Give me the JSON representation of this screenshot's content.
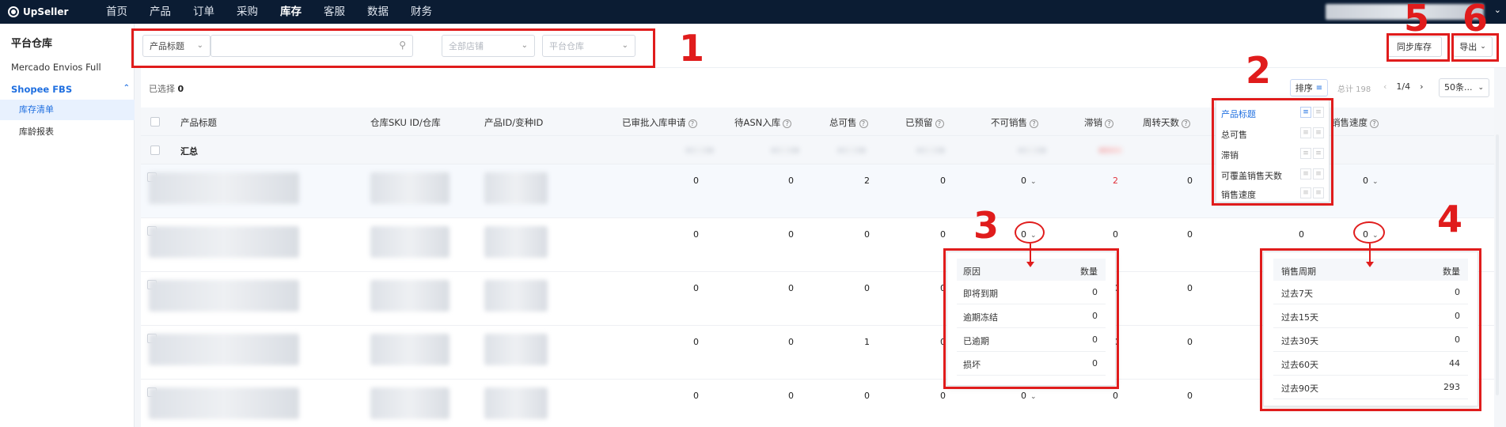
{
  "app": {
    "logo": "UpSeller"
  },
  "nav": [
    "首页",
    "产品",
    "订单",
    "采购",
    "库存",
    "客服",
    "数据",
    "财务"
  ],
  "nav_active": "库存",
  "sidebar": {
    "title": "平台仓库",
    "items": [
      "Mercado Envios Full"
    ],
    "group": "Shopee FBS",
    "sub_items": [
      "库存清单",
      "库龄报表"
    ]
  },
  "filters": {
    "search_field": "产品标题",
    "search_value": "",
    "shop_placeholder": "全部店铺",
    "warehouse_placeholder": "平台仓库",
    "sync_button": "同步库存",
    "export_button": "导出"
  },
  "toolbar": {
    "selected_label": "已选择",
    "selected_count": "0",
    "sort_button": "排序",
    "total": "总计 198",
    "page": "1/4",
    "page_size": "50条..."
  },
  "columns": [
    "产品标题",
    "仓库SKU ID/仓库",
    "产品ID/变种ID",
    "已审批入库申请",
    "待ASN入库",
    "总可售",
    "已预留",
    "不可销售",
    "滞销",
    "周转天数",
    "销售速度"
  ],
  "summary_label": "汇总",
  "rows": [
    {
      "approved": "0",
      "asn": "0",
      "sellable": "2",
      "reserved": "0",
      "unsellable": "0",
      "slow": "2",
      "slow_red": true,
      "turnover": "0",
      "speed": "0"
    },
    {
      "approved": "0",
      "asn": "0",
      "sellable": "0",
      "reserved": "0",
      "unsellable": "0",
      "slow": "0",
      "slow_red": false,
      "turnover": "0",
      "cover": "0",
      "speed": "0"
    },
    {
      "approved": "0",
      "asn": "0",
      "sellable": "0",
      "reserved": "0",
      "unsellable": "",
      "slow": "0",
      "slow_red": false,
      "turnover": "0",
      "speed": ""
    },
    {
      "approved": "0",
      "asn": "0",
      "sellable": "1",
      "reserved": "0",
      "unsellable": "",
      "slow": "0",
      "slow_red": false,
      "turnover": "0",
      "speed": ""
    },
    {
      "approved": "0",
      "asn": "0",
      "sellable": "0",
      "reserved": "0",
      "unsellable": "0",
      "slow": "0",
      "slow_red": false,
      "turnover": "0",
      "speed": ""
    }
  ],
  "sort_popup": {
    "items": [
      "产品标题",
      "总可售",
      "滞销",
      "可覆盖销售天数",
      "销售速度"
    ],
    "active": "产品标题"
  },
  "unsellable_popup": {
    "headers": [
      "原因",
      "数量"
    ],
    "rows": [
      {
        "reason": "即将到期",
        "qty": "0"
      },
      {
        "reason": "逾期冻结",
        "qty": "0"
      },
      {
        "reason": "已逾期",
        "qty": "0"
      },
      {
        "reason": "损坏",
        "qty": "0"
      }
    ]
  },
  "speed_popup": {
    "headers": [
      "销售周期",
      "数量"
    ],
    "rows": [
      {
        "period": "过去7天",
        "qty": "0"
      },
      {
        "period": "过去15天",
        "qty": "0"
      },
      {
        "period": "过去30天",
        "qty": "0"
      },
      {
        "period": "过去60天",
        "qty": "44"
      },
      {
        "period": "过去90天",
        "qty": "293"
      }
    ]
  },
  "annotations": [
    "1",
    "2",
    "3",
    "4",
    "5",
    "6"
  ],
  "colors": {
    "topbar": "#0b1c33",
    "accent": "#1f6fe0",
    "annotation": "#e01c1c",
    "danger": "#e0303a"
  }
}
